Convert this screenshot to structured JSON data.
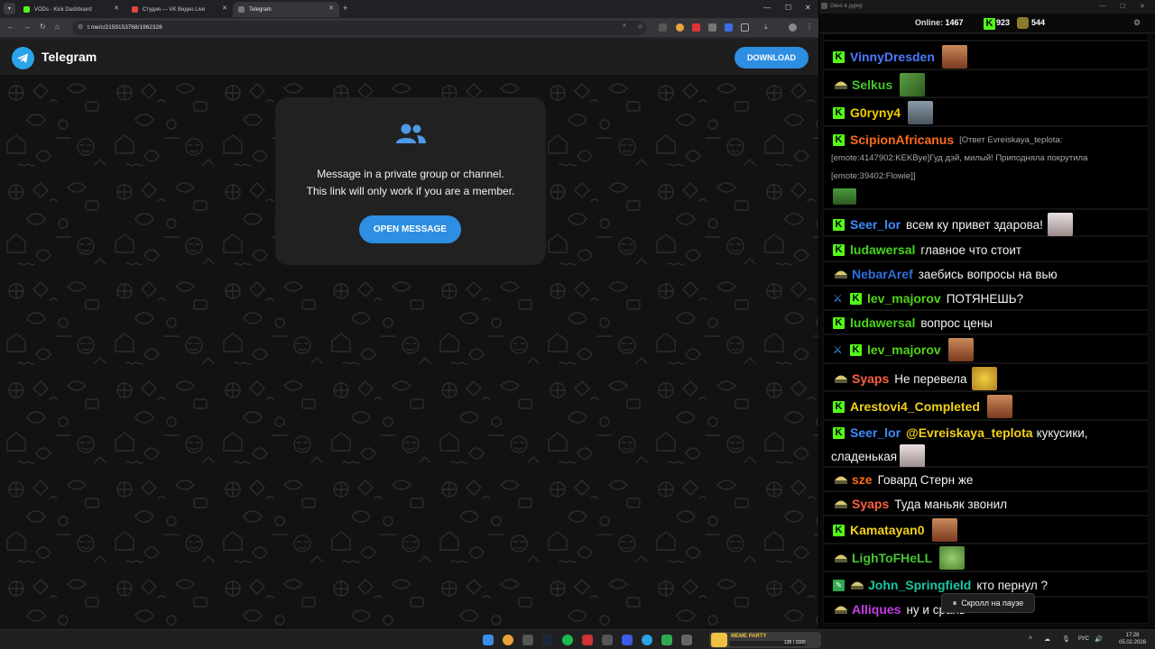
{
  "browser": {
    "tabs": [
      {
        "label": "VODs - Kick Dashboard",
        "favicon_color": "#53fc18",
        "active": false
      },
      {
        "label": "Студия — VK Видео Live",
        "favicon_color": "#e8433e",
        "active": false
      },
      {
        "label": "Telegram",
        "favicon_color": "#777777",
        "active": true
      }
    ],
    "url": "t.me/c/2159153768/1962328"
  },
  "telegram": {
    "title": "Telegram",
    "download_label": "DOWNLOAD",
    "card_line1": "Message in a private group or channel.",
    "card_line2": "This link will only work if you are a member.",
    "open_label": "OPEN MESSAGE",
    "accent": "#2d8ee2"
  },
  "chat": {
    "window_title": "Окно в дурку",
    "online_label": "Online:",
    "online_count": "1467",
    "kick_count": "923",
    "other_count": "544",
    "pause_label": "Скролл на паузе",
    "messages": [
      {
        "user": "VinnyDresden",
        "color": "#4a7bff",
        "text": ""
      },
      {
        "user": "Selkus",
        "color": "#48c430",
        "text": ""
      },
      {
        "user": "G0ryny4",
        "color": "#f0d000",
        "text": ""
      },
      {
        "user": "ScipionAfricanus",
        "color": "#ff6a1a",
        "reply_line1": "[Ответ Evreiskaya_teplota:",
        "reply_line2": "[emote:4147902:KEKBye]Гуд дэй, милый! Приподняла покрутила",
        "reply_line3": "[emote:39402:Flowie]]"
      },
      {
        "user": "Seer_lor",
        "color": "#3e8bff",
        "text": "всем ку привет здарова!"
      },
      {
        "user": "ludawersal",
        "color": "#4ad41c",
        "text": "главное что стоит"
      },
      {
        "user": "NebarAref",
        "color": "#2f6fdf",
        "text": "заебись вопросы на вью"
      },
      {
        "user": "lev_majorov",
        "color": "#50d418",
        "text": "ПОТЯНЕШЬ?"
      },
      {
        "user": "ludawersal",
        "color": "#4ad41c",
        "text": "вопрос цены"
      },
      {
        "user": "lev_majorov",
        "color": "#50d418",
        "text": ""
      },
      {
        "user": "Syaps",
        "color": "#ff6040",
        "text": "Не перевела"
      },
      {
        "user": "Arestovi4_Completed",
        "color": "#f2d11a",
        "text": ""
      },
      {
        "user": "Seer_lor",
        "color": "#3e8bff",
        "mention": "@Evreiskaya_teplota",
        "text": "кукусики,",
        "text2": "сладенькая"
      },
      {
        "user": "sze",
        "color": "#ff6a1a",
        "text": "Говард Стерн же"
      },
      {
        "user": "Syaps",
        "color": "#ff6040",
        "text": "Туда маньяк звонил"
      },
      {
        "user": "Kamatayan0",
        "color": "#f2d11a",
        "text": ""
      },
      {
        "user": "LighToFHeLL",
        "color": "#48c430",
        "text": ""
      },
      {
        "user": "John_Springfield",
        "color": "#19c7a3",
        "text": "кто пернул ?"
      },
      {
        "user": "Alliques",
        "color": "#c43ee8",
        "text": "ну и срань"
      }
    ]
  },
  "taskbar": {
    "meme_label": "MEME PARTY",
    "meme_count": "135 / 1500",
    "lang": "РУС",
    "time": "17:28",
    "date": "05.02.2026"
  }
}
